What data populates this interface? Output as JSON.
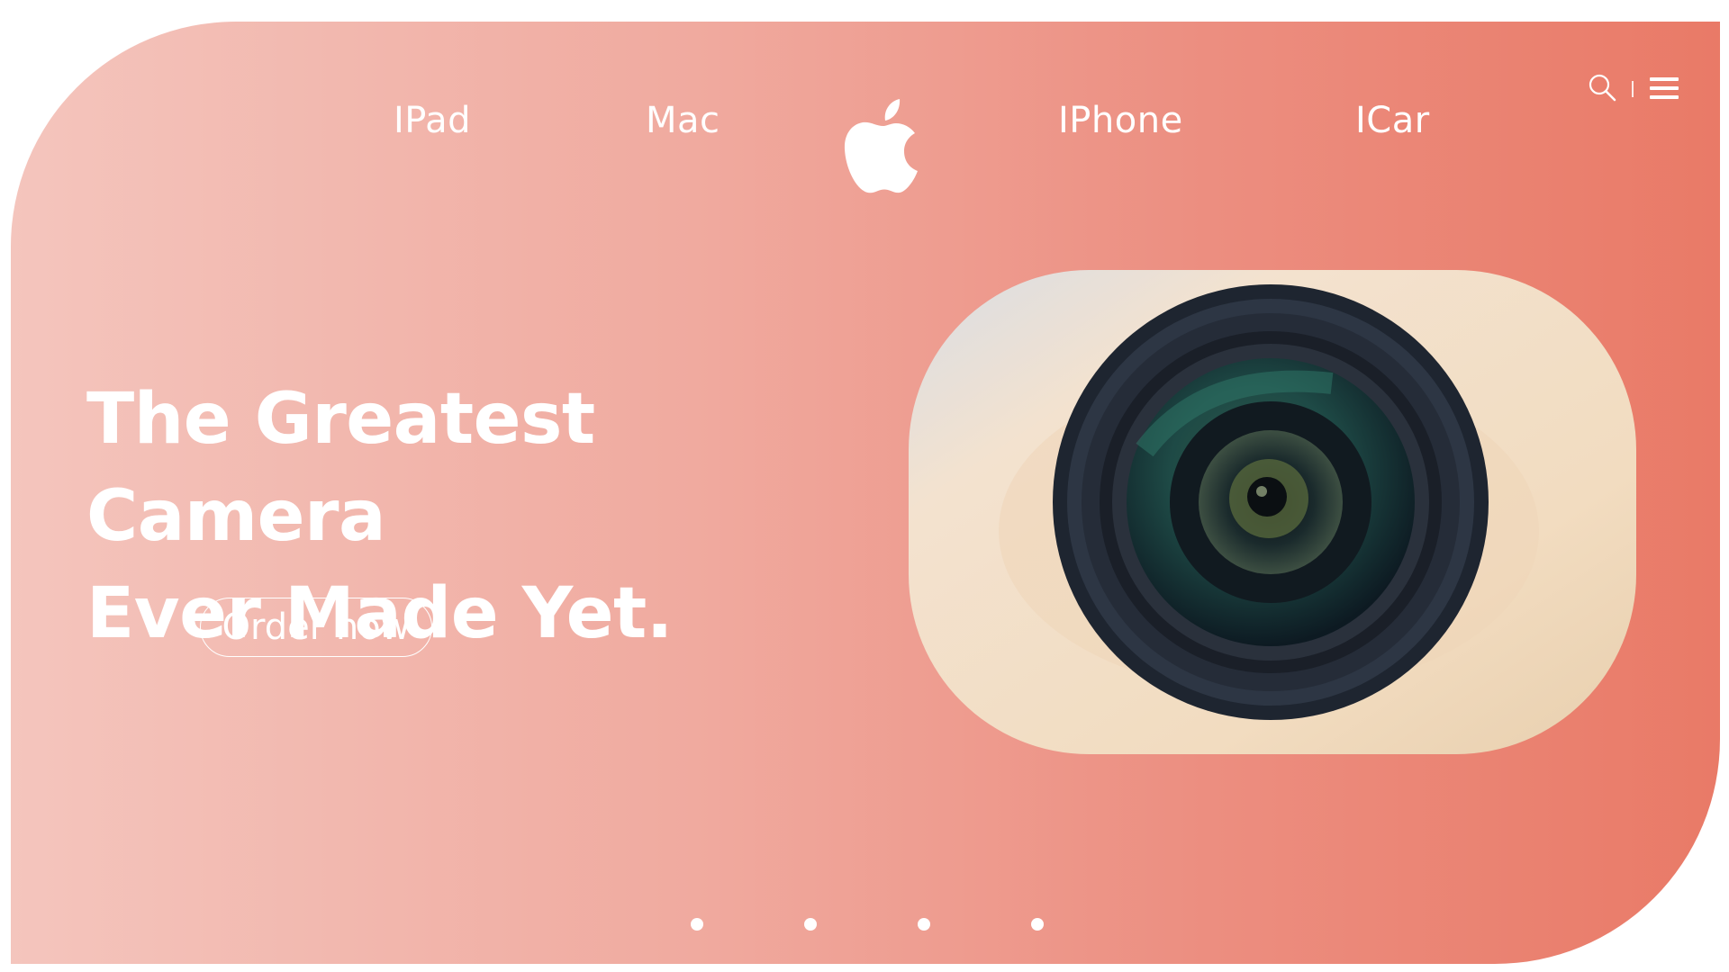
{
  "nav": {
    "links": [
      {
        "label": "IPad"
      },
      {
        "label": "Mac"
      },
      {
        "label": "IPhone"
      },
      {
        "label": "ICar"
      }
    ],
    "logo_icon": "apple-logo-icon",
    "search_icon": "search-icon",
    "menu_icon": "hamburger-menu-icon"
  },
  "hero": {
    "headline_line1": "The Greatest Camera",
    "headline_line2": "Ever Made Yet.",
    "cta_label": "Order now",
    "image": "camera-lens-photo"
  },
  "carousel": {
    "dot_count": 4
  },
  "colors": {
    "gradient_start": "#f4c5bd",
    "gradient_end": "#e97a67",
    "text": "#ffffff"
  }
}
